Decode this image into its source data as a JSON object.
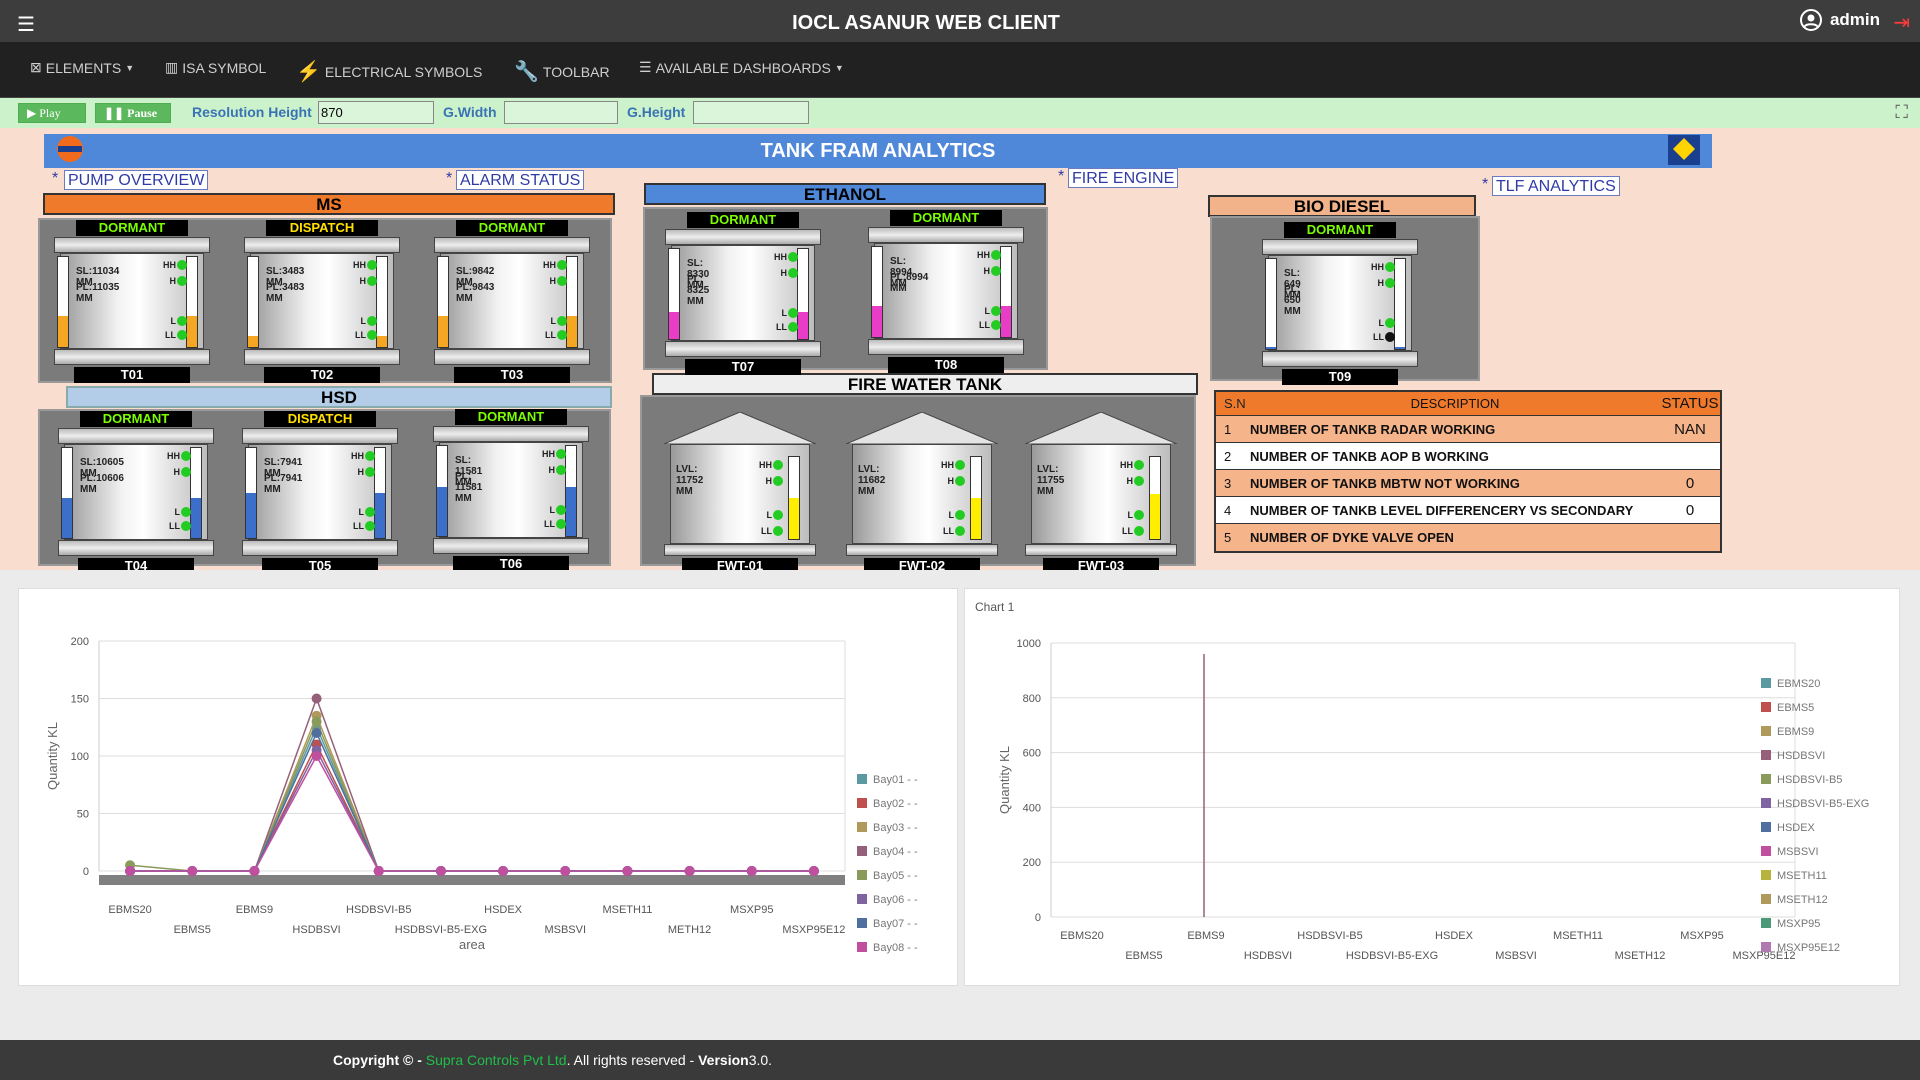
{
  "app": {
    "title": "IOCL ASANUR WEB CLIENT",
    "user": "admin"
  },
  "menu": [
    {
      "label": "ELEMENTS",
      "icon": "elements-icon"
    },
    {
      "label": "ISA SYMBOL",
      "icon": "chart-icon"
    },
    {
      "label": "ELECTRICAL SYMBOLS",
      "icon": "tower-icon"
    },
    {
      "label": "TOOLBAR",
      "icon": "wrench-icon"
    },
    {
      "label": "AVAILABLE DASHBOARDS",
      "icon": "list-icon"
    }
  ],
  "controls": {
    "play": "Play",
    "pause": "Pause",
    "res_height_label": "Resolution Height",
    "res_height_value": "870",
    "gwidth_label": "G.Width",
    "gheight_label": "G.Height",
    "gwidth_value": "",
    "gheight_value": ""
  },
  "scada": {
    "banner": "TANK FRAM ANALYTICS",
    "links": [
      "PUMP OVERVIEW",
      "ALARM STATUS",
      "FIRE ENGINE",
      "TLF ANALYTICS"
    ],
    "groups": {
      "ms": "MS",
      "hsd": "HSD",
      "ethanol": "ETHANOL",
      "bio": "BIO DIESEL",
      "fire": "FIRE WATER TANK"
    },
    "level_labels": [
      "HH",
      "H",
      "L",
      "LL"
    ],
    "tanks": [
      {
        "name": "T01",
        "state": "DORMANT",
        "sl": "SL:11034 MM",
        "pl": "PL:11035 MM",
        "fill": 0.35,
        "color": "#f5a623"
      },
      {
        "name": "T02",
        "state": "DISPATCH",
        "sl": "SL:3483 MM",
        "pl": "PL:3483 MM",
        "fill": 0.12,
        "color": "#f5a623"
      },
      {
        "name": "T03",
        "state": "DORMANT",
        "sl": "SL:9842 MM",
        "pl": "PL:9843 MM",
        "fill": 0.35,
        "color": "#f5a623"
      },
      {
        "name": "T04",
        "state": "DORMANT",
        "sl": "SL:10605 MM",
        "pl": "PL:10606 MM",
        "fill": 0.45,
        "color": "#3b6fc9"
      },
      {
        "name": "T05",
        "state": "DISPATCH",
        "sl": "SL:7941 MM",
        "pl": "PL:7941 MM",
        "fill": 0.5,
        "color": "#3b6fc9"
      },
      {
        "name": "T06",
        "state": "DORMANT",
        "sl": "SL: 11581 MM",
        "pl": "PL: 11581 MM",
        "fill": 0.55,
        "color": "#3b6fc9"
      },
      {
        "name": "T07",
        "state": "DORMANT",
        "sl": "SL: 8330 MM",
        "pl": "PL: 8325 MM",
        "fill": 0.3,
        "color": "#e83ec7"
      },
      {
        "name": "T08",
        "state": "DORMANT",
        "sl": "SL: 8994 MM",
        "pl": "PL:8994 MM",
        "fill": 0.35,
        "color": "#e83ec7"
      },
      {
        "name": "T09",
        "state": "DORMANT",
        "sl": "SL: 649 MM",
        "pl": "PL: 650 MM",
        "fill": 0.02,
        "color": "#3b6fc9"
      }
    ],
    "fire_tanks": [
      {
        "name": "FWT-01",
        "lvl": "LVL: 11752 MM",
        "fill": 0.5
      },
      {
        "name": "FWT-02",
        "lvl": "LVL: 11682 MM",
        "fill": 0.5
      },
      {
        "name": "FWT-03",
        "lvl": "LVL: 11755 MM",
        "fill": 0.55
      }
    ],
    "table": {
      "headers": [
        "S.N",
        "DESCRIPTION",
        "STATUS"
      ],
      "rows": [
        {
          "sn": "1",
          "desc": "NUMBER OF TANKB RADAR WORKING",
          "status": "NAN"
        },
        {
          "sn": "2",
          "desc": "NUMBER OF TANKB AOP B WORKING",
          "status": ""
        },
        {
          "sn": "3",
          "desc": "NUMBER OF TANKB MBTW NOT WORKING",
          "status": "0"
        },
        {
          "sn": "4",
          "desc": "NUMBER OF TANKB LEVEL DIFFERENCERY VS SECONDARY",
          "status": "0"
        },
        {
          "sn": "5",
          "desc": "NUMBER OF DYKE VALVE OPEN",
          "status": ""
        }
      ]
    }
  },
  "chart_data": [
    {
      "type": "line",
      "title": "",
      "xlabel": "area",
      "ylabel": "Quantity KL",
      "ylim": [
        0,
        200
      ],
      "yticks": [
        0,
        50,
        100,
        150,
        200
      ],
      "categories": [
        "EBMS20",
        "EBMS5",
        "EBMS9",
        "HSDBSVI",
        "HSDBSVI-B5",
        "HSDBSVI-B5-EXG",
        "HSDEX",
        "MSBSVI",
        "MSETH11",
        "METH12",
        "MSXP95",
        "MSXP95E12"
      ],
      "legend_placement": "right",
      "series": [
        {
          "name": "Bay01 - -",
          "color": "#5b9aa0",
          "values": [
            0,
            0,
            0,
            125,
            0,
            0,
            0,
            0,
            0,
            0,
            0,
            0
          ]
        },
        {
          "name": "Bay02 - -",
          "color": "#c0504d",
          "values": [
            0,
            0,
            0,
            110,
            0,
            0,
            0,
            0,
            0,
            0,
            0,
            0
          ]
        },
        {
          "name": "Bay03 - -",
          "color": "#b09a5b",
          "values": [
            0,
            0,
            0,
            135,
            0,
            0,
            0,
            0,
            0,
            0,
            0,
            0
          ]
        },
        {
          "name": "Bay04 - -",
          "color": "#96607a",
          "values": [
            0,
            0,
            0,
            150,
            0,
            0,
            0,
            0,
            0,
            0,
            0,
            0
          ]
        },
        {
          "name": "Bay05 - -",
          "color": "#8a9a5b",
          "values": [
            5,
            0,
            0,
            130,
            0,
            0,
            0,
            0,
            0,
            0,
            0,
            0
          ]
        },
        {
          "name": "Bay06 - -",
          "color": "#8064a2",
          "values": [
            0,
            0,
            0,
            105,
            0,
            0,
            0,
            0,
            0,
            0,
            0,
            0
          ]
        },
        {
          "name": "Bay07 - -",
          "color": "#4f6f9f",
          "values": [
            0,
            0,
            0,
            120,
            0,
            0,
            0,
            0,
            0,
            0,
            0,
            0
          ]
        },
        {
          "name": "Bay08 - -",
          "color": "#c04fa0",
          "values": [
            0,
            0,
            0,
            100,
            0,
            0,
            0,
            0,
            0,
            0,
            0,
            0
          ]
        }
      ]
    },
    {
      "type": "line",
      "title": "Chart 1",
      "xlabel": "",
      "ylabel": "Quantity KL",
      "ylim": [
        0,
        1000
      ],
      "yticks": [
        0,
        200,
        400,
        600,
        800,
        1000
      ],
      "categories": [
        "EBMS20",
        "EBMS5",
        "EBMS9",
        "HSDBSVI",
        "HSDBSVI-B5",
        "HSDBSVI-B5-EXG",
        "HSDEX",
        "MSBSVI",
        "MSETH11",
        "MSETH12",
        "MSXP95",
        "MSXP95E12"
      ],
      "legend_placement": "right",
      "series": [
        {
          "name": "EBMS20",
          "color": "#5b9aa0"
        },
        {
          "name": "EBMS5",
          "color": "#c0504d"
        },
        {
          "name": "EBMS9",
          "color": "#b09a5b"
        },
        {
          "name": "HSDBSVI",
          "color": "#96607a",
          "spike": {
            "category": "EBMS9",
            "value": 960
          }
        },
        {
          "name": "HSDBSVI-B5",
          "color": "#8a9a5b"
        },
        {
          "name": "HSDBSVI-B5-EXG",
          "color": "#8064a2"
        },
        {
          "name": "HSDEX",
          "color": "#4f6f9f"
        },
        {
          "name": "MSBSVI",
          "color": "#c04fa0"
        },
        {
          "name": "MSETH11",
          "color": "#b6b43c"
        },
        {
          "name": "MSETH12",
          "color": "#b09a5b"
        },
        {
          "name": "MSXP95",
          "color": "#4a9a7a"
        },
        {
          "name": "MSXP95E12",
          "color": "#b07ab0"
        }
      ]
    }
  ],
  "footer": {
    "copyright": "Copyright © - ",
    "company": "Supra Controls Pvt Ltd",
    "rights": ". All rights reserved - ",
    "version_label": "Version",
    "version": "3.0."
  }
}
